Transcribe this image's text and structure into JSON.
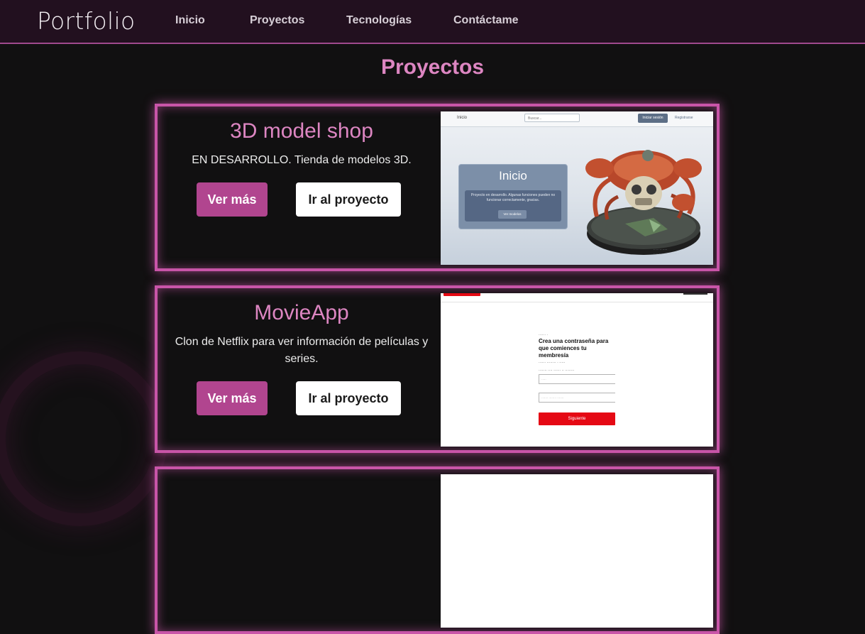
{
  "nav": {
    "brand": "Portfolio",
    "links": [
      "Inicio",
      "Proyectos",
      "Tecnologías",
      "Contáctame"
    ]
  },
  "section_title": "Proyectos",
  "projects": [
    {
      "title": "3D model shop",
      "description": "EN DESARROLLO. Tienda de modelos 3D.",
      "more_label": "Ver más",
      "go_label": "Ir al proyecto",
      "preview": {
        "nav_home": "Inicio",
        "search_placeholder": "Buscar...",
        "login": "Iniciar sesión",
        "register": "Registrarse",
        "panel_title": "Inicio",
        "panel_text": "Proyecto en desarrollo. Algunas funciones pueden no funcionar correctamente, gracias.",
        "panel_button": "Ver modelos"
      }
    },
    {
      "title": "MovieApp",
      "description": "Clon de Netflix para ver información de películas y series.",
      "more_label": "Ver más",
      "go_label": "Ir al proyecto",
      "preview": {
        "heading": "Crea una contraseña para que comiences tu membresía",
        "next": "Siguiente"
      }
    }
  ],
  "colors": {
    "accent": "#dd86c2",
    "border": "#c855a8",
    "button": "#b1458f",
    "navbar": "#22101f",
    "background": "#111011"
  }
}
